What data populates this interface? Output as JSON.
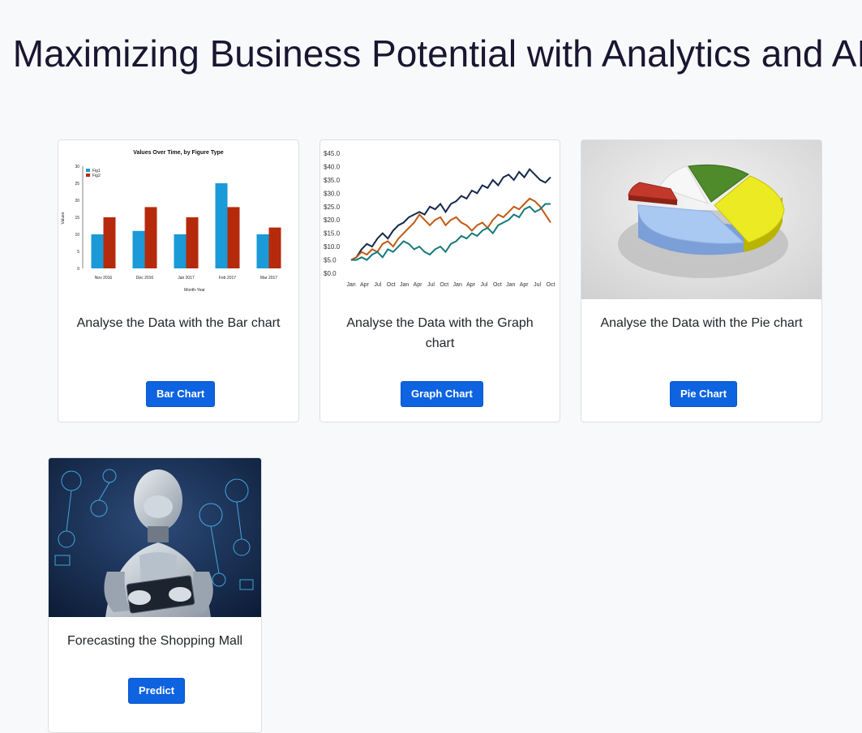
{
  "page": {
    "title": "Maximizing Business Potential with Analytics and AI"
  },
  "cards": [
    {
      "text": "Analyse the Data with the Bar chart",
      "button": "Bar Chart",
      "image_chart": {
        "type": "bar",
        "title": "Values Over Time, by Figure Type",
        "xlabel": "Month-Year",
        "ylabel": "Values",
        "categories": [
          "Nov 2016",
          "Dec 2016",
          "Jan 2017",
          "Feb 2017",
          "Mar 2017"
        ],
        "series": [
          {
            "name": "Fig1",
            "values": [
              10,
              11,
              10,
              25,
              10
            ],
            "color": "#1a9ad6"
          },
          {
            "name": "Fig2",
            "values": [
              15,
              18,
              15,
              18,
              12
            ],
            "color": "#b52a0b"
          }
        ],
        "ylim": [
          0,
          30
        ],
        "yticks": [
          "0",
          "5",
          "10",
          "15",
          "20",
          "25",
          "30"
        ]
      }
    },
    {
      "text": "Analyse the Data with the Graph chart",
      "button": "Graph Chart",
      "image_chart": {
        "type": "line",
        "yticks": [
          "$0.0",
          "$5.0",
          "$10.0",
          "$15.0",
          "$20.0",
          "$25.0",
          "$30.0",
          "$35.0",
          "$40.0",
          "$45.0"
        ],
        "xticks": [
          "Jan",
          "Apr",
          "Jul",
          "Oct",
          "Jan",
          "Apr",
          "Jul",
          "Oct",
          "Jan",
          "Apr",
          "Jul",
          "Oct",
          "Jan",
          "Apr",
          "Jul",
          "Oct"
        ],
        "ylim": [
          0,
          45
        ],
        "series": [
          {
            "color": "#14284b",
            "values": [
              5,
              6,
              9,
              11,
              10,
              13,
              15,
              13,
              16,
              18,
              19,
              21,
              22,
              23,
              22,
              25,
              24,
              26,
              23,
              26,
              27,
              29,
              28,
              31,
              30,
              33,
              32,
              35,
              33,
              36,
              37,
              35,
              38,
              36,
              39,
              37,
              35,
              34,
              36
            ]
          },
          {
            "color": "#c05a12",
            "values": [
              5,
              6,
              8,
              7,
              9,
              8,
              11,
              12,
              10,
              13,
              15,
              17,
              19,
              22,
              20,
              18,
              20,
              21,
              18,
              20,
              21,
              19,
              18,
              16,
              18,
              19,
              17,
              20,
              22,
              21,
              23,
              25,
              24,
              26,
              28,
              27,
              25,
              22,
              19
            ]
          },
          {
            "color": "#157a7a",
            "values": [
              5,
              5,
              6,
              5,
              7,
              8,
              6,
              9,
              8,
              10,
              12,
              11,
              9,
              10,
              8,
              7,
              9,
              10,
              8,
              11,
              12,
              14,
              13,
              15,
              14,
              16,
              17,
              15,
              18,
              19,
              20,
              22,
              21,
              24,
              25,
              23,
              24,
              26,
              26
            ]
          }
        ]
      }
    },
    {
      "text": "Analyse the Data with the Pie chart",
      "button": "Pie Chart"
    },
    {
      "text": "Forecasting the Shopping Mall",
      "button": "Predict"
    }
  ],
  "colors": {
    "button_bg": "#0d63e0",
    "title": "#1a1530",
    "page_bg": "#f8f9fb"
  }
}
